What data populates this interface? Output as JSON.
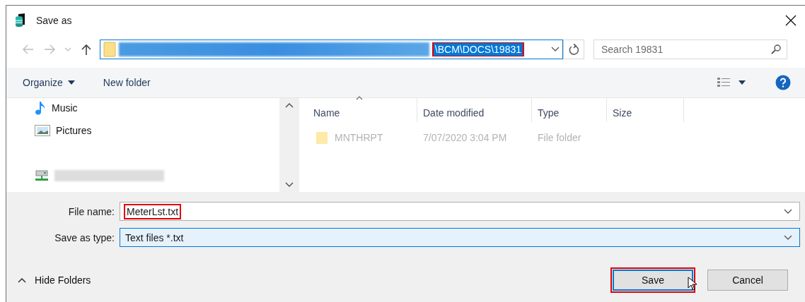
{
  "window": {
    "title": "Save as"
  },
  "address_bar": {
    "path": "\\BCM\\DOCS\\19831",
    "selected": true,
    "highlighted": true
  },
  "search": {
    "placeholder": "Search 19831"
  },
  "toolbar": {
    "organize": "Organize",
    "new_folder": "New folder"
  },
  "sidebar": {
    "items": [
      {
        "label": "Music",
        "kind": "music"
      },
      {
        "label": "Pictures",
        "kind": "pictures"
      },
      {
        "kind": "drive"
      }
    ]
  },
  "file_list": {
    "columns": [
      {
        "label": "Name",
        "sorted": true
      },
      {
        "label": "Date modified",
        "sorted": false
      },
      {
        "label": "Type",
        "sorted": false
      },
      {
        "label": "Size",
        "sorted": false
      }
    ],
    "rows": [
      {
        "name": "MNTHRPT",
        "date_modified": "7/07/2020 3:04 PM",
        "type": "File folder"
      }
    ]
  },
  "form": {
    "file_name": {
      "label": "File name:",
      "value": "MeterLst.txt",
      "highlighted": true
    },
    "save_as_type": {
      "label": "Save as type:",
      "value": "Text files *.txt",
      "focused": true
    }
  },
  "hide_folders": "Hide Folders",
  "buttons": [
    {
      "label": "Save",
      "default": true,
      "highlighted": true
    },
    {
      "label": "Cancel",
      "default": false,
      "highlighted": false
    }
  ]
}
